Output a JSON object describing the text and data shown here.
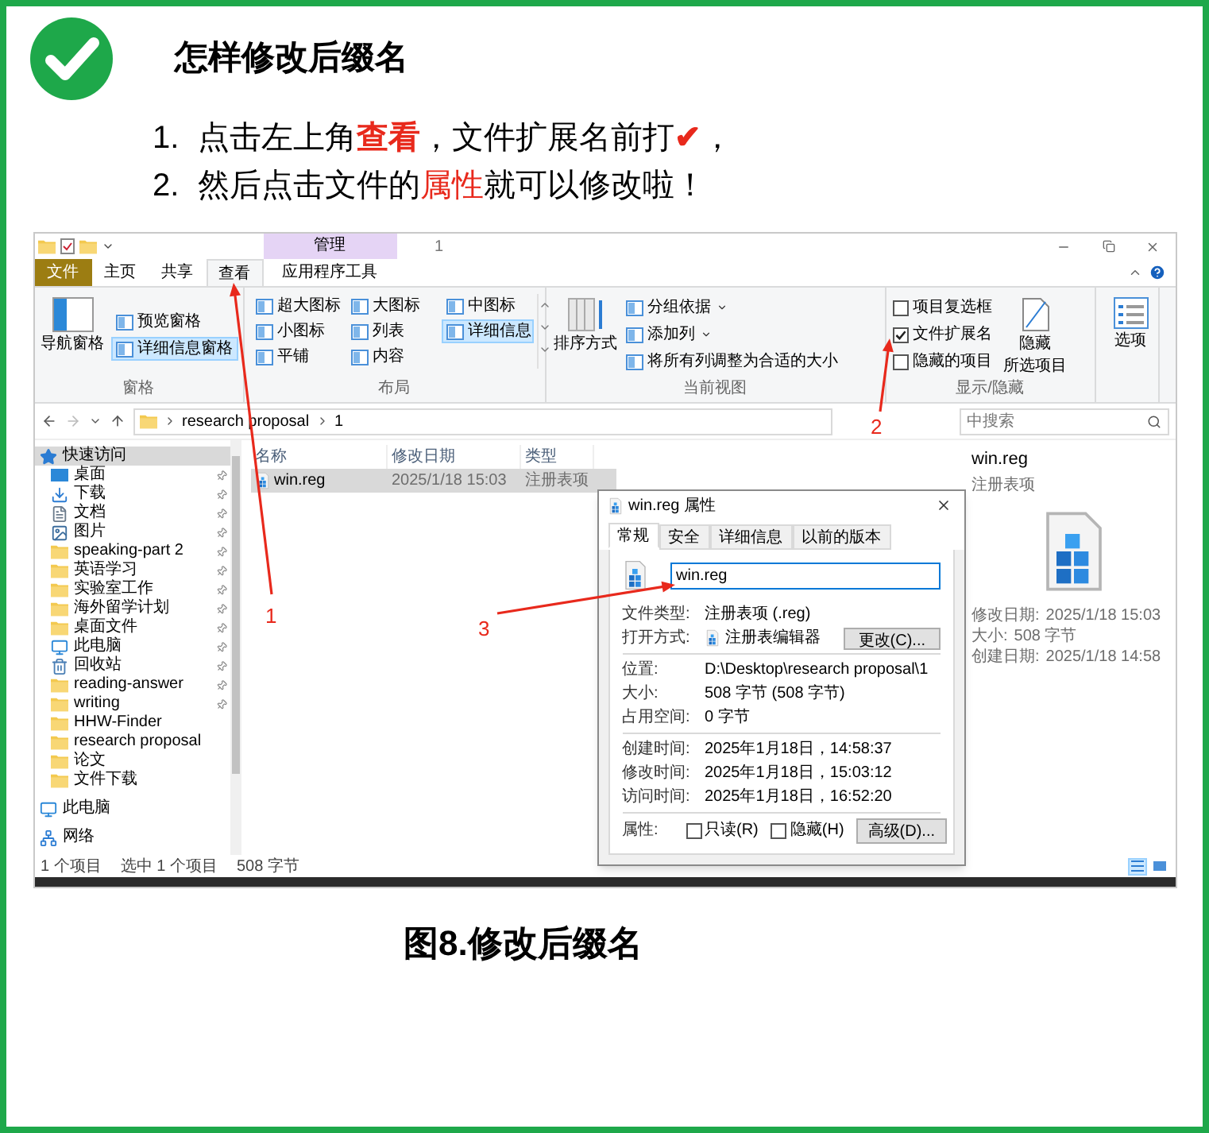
{
  "header": {
    "title": "怎样修改后缀名"
  },
  "steps": [
    {
      "number": "1.",
      "parts": [
        {
          "text": "点击左上角",
          "accent": false,
          "bold": false
        },
        {
          "text": "查看",
          "accent": true,
          "bold": true
        },
        {
          "text": "，文件扩展名前打",
          "accent": false,
          "bold": false
        },
        {
          "text": "✔",
          "accent": true,
          "bold": true
        },
        {
          "text": "，",
          "accent": false,
          "bold": false
        }
      ]
    },
    {
      "number": "2.",
      "parts": [
        {
          "text": "然后点击文件的",
          "accent": false,
          "bold": false
        },
        {
          "text": "属性",
          "accent": true,
          "bold": false
        },
        {
          "text": "就可以修改啦！",
          "accent": false,
          "bold": false
        }
      ]
    }
  ],
  "explorer": {
    "context_label": "管理",
    "title": "1",
    "tabs": [
      {
        "label": "文件",
        "kind": "file",
        "selected": false
      },
      {
        "label": "主页",
        "kind": "normal",
        "selected": false
      },
      {
        "label": "共享",
        "kind": "normal",
        "selected": false
      },
      {
        "label": "查看",
        "kind": "normal",
        "selected": true
      },
      {
        "label": "应用程序工具",
        "kind": "context",
        "selected": false
      }
    ],
    "ribbon": [
      {
        "kind": "panes",
        "label": "窗格",
        "large": [
          "导航窗格"
        ],
        "items": [
          {
            "label": "预览窗格",
            "selected": false
          },
          {
            "label": "详细信息窗格",
            "selected": true
          }
        ]
      },
      {
        "kind": "layout",
        "label": "布局",
        "items": [
          {
            "label": "超大图标",
            "selected": false
          },
          {
            "label": "小图标",
            "selected": false
          },
          {
            "label": "平铺",
            "selected": false
          },
          {
            "label": "大图标",
            "selected": false
          },
          {
            "label": "列表",
            "selected": false
          },
          {
            "label": "内容",
            "selected": false
          },
          {
            "label": "中图标",
            "selected": false
          },
          {
            "label": "详细信息",
            "selected": true
          }
        ]
      },
      {
        "kind": "view",
        "label": "当前视图",
        "large": [
          "排序方式"
        ],
        "items": [
          {
            "label": "分组依据",
            "dropdown": true
          },
          {
            "label": "添加列",
            "dropdown": true
          },
          {
            "label": "将所有列调整为合适的大小",
            "dropdown": false
          }
        ]
      },
      {
        "kind": "show_hide",
        "label": "显示/隐藏",
        "checks": [
          {
            "label": "项目复选框",
            "checked": false
          },
          {
            "label": "文件扩展名",
            "checked": true
          },
          {
            "label": "隐藏的项目",
            "checked": false
          }
        ],
        "large": [
          "隐藏",
          "所选项目"
        ]
      },
      {
        "kind": "options",
        "large": [
          "选项"
        ]
      }
    ],
    "address": [
      "research proposal",
      "1"
    ],
    "search": {
      "placeholder": "中搜索"
    },
    "sidebar": [
      {
        "label": "快速访问",
        "kind": "quick",
        "selected": true,
        "pinned": false,
        "children": [
          {
            "label": "桌面",
            "kind": "desktop",
            "selected": false,
            "pinned": true
          },
          {
            "label": "下载",
            "kind": "download",
            "selected": false,
            "pinned": true
          },
          {
            "label": "文档",
            "kind": "document",
            "selected": false,
            "pinned": true
          },
          {
            "label": "图片",
            "kind": "picture",
            "selected": false,
            "pinned": true
          },
          {
            "label": "speaking-part 2",
            "kind": "folder",
            "selected": false,
            "pinned": true
          },
          {
            "label": "英语学习",
            "kind": "folder",
            "selected": false,
            "pinned": true
          },
          {
            "label": "实验室工作",
            "kind": "folder",
            "selected": false,
            "pinned": true
          },
          {
            "label": "海外留学计划",
            "kind": "folder",
            "selected": false,
            "pinned": true
          },
          {
            "label": "桌面文件",
            "kind": "folder",
            "selected": false,
            "pinned": true
          },
          {
            "label": "此电脑",
            "kind": "pc",
            "selected": false,
            "pinned": true
          },
          {
            "label": "回收站",
            "kind": "recycle",
            "selected": false,
            "pinned": true
          },
          {
            "label": "reading-answer",
            "kind": "folder",
            "selected": false,
            "pinned": true
          },
          {
            "label": "writing",
            "kind": "folder",
            "selected": false,
            "pinned": true
          },
          {
            "label": "HHW-Finder",
            "kind": "folder",
            "selected": false,
            "pinned": false
          },
          {
            "label": "research proposal",
            "kind": "folder",
            "selected": false,
            "pinned": false
          },
          {
            "label": "论文",
            "kind": "folder",
            "selected": false,
            "pinned": false
          },
          {
            "label": "文件下载",
            "kind": "folder",
            "selected": false,
            "pinned": false
          }
        ]
      },
      {
        "label": "此电脑",
        "kind": "pc",
        "selected": false,
        "pinned": false
      },
      {
        "label": "网络",
        "kind": "network",
        "selected": false,
        "pinned": false
      }
    ],
    "file_list": {
      "columns": [
        "名称",
        "修改日期",
        "类型"
      ],
      "rows": [
        {
          "cells": [
            "win.reg",
            "2025/1/18 15:03",
            "注册表项"
          ],
          "selected": true
        }
      ]
    },
    "details_pane": {
      "name": "win.reg",
      "type": "注册表项",
      "fields": [
        {
          "label": "修改日期:",
          "value": "2025/1/18 15:03"
        },
        {
          "label": "大小:",
          "value": "508 字节"
        },
        {
          "label": "创建日期:",
          "value": "2025/1/18 14:58"
        }
      ]
    },
    "status_bar": [
      "1 个项目",
      "选中 1 个项目",
      "508 字节"
    ],
    "view_buttons": [
      {
        "kind": "details",
        "selected": true
      },
      {
        "kind": "large_icons",
        "selected": false
      }
    ]
  },
  "dialog": {
    "title": "win.reg 属性",
    "tabs": [
      {
        "label": "常规",
        "selected": true
      },
      {
        "label": "安全",
        "selected": false
      },
      {
        "label": "详细信息",
        "selected": false
      },
      {
        "label": "以前的版本",
        "selected": false
      }
    ],
    "name": "win.reg",
    "sections": [
      [
        {
          "label": "文件类型:",
          "value": "注册表项 (.reg)",
          "kind": "text"
        },
        {
          "label": "打开方式:",
          "value": "注册表编辑器",
          "kind": "app",
          "button": "更改(C)..."
        }
      ],
      [
        {
          "label": "位置:",
          "value": "D:\\Desktop\\research proposal\\1",
          "kind": "text"
        },
        {
          "label": "大小:",
          "value": "508 字节 (508 字节)",
          "kind": "text"
        },
        {
          "label": "占用空间:",
          "value": "0 字节",
          "kind": "text"
        }
      ],
      [
        {
          "label": "创建时间:",
          "value": "2025年1月18日，14:58:37",
          "kind": "text"
        },
        {
          "label": "修改时间:",
          "value": "2025年1月18日，15:03:12",
          "kind": "text"
        },
        {
          "label": "访问时间:",
          "value": "2025年1月18日，16:52:20",
          "kind": "text"
        }
      ]
    ],
    "attributes": {
      "label": "属性:",
      "checks": [
        {
          "label": "只读(R)",
          "checked": false
        },
        {
          "label": "隐藏(H)",
          "checked": false
        }
      ],
      "button": "高级(D)..."
    }
  },
  "annotations": [
    {
      "label": "1"
    },
    {
      "label": "2"
    },
    {
      "label": "3"
    }
  ],
  "caption": "图8.修改后缀名"
}
